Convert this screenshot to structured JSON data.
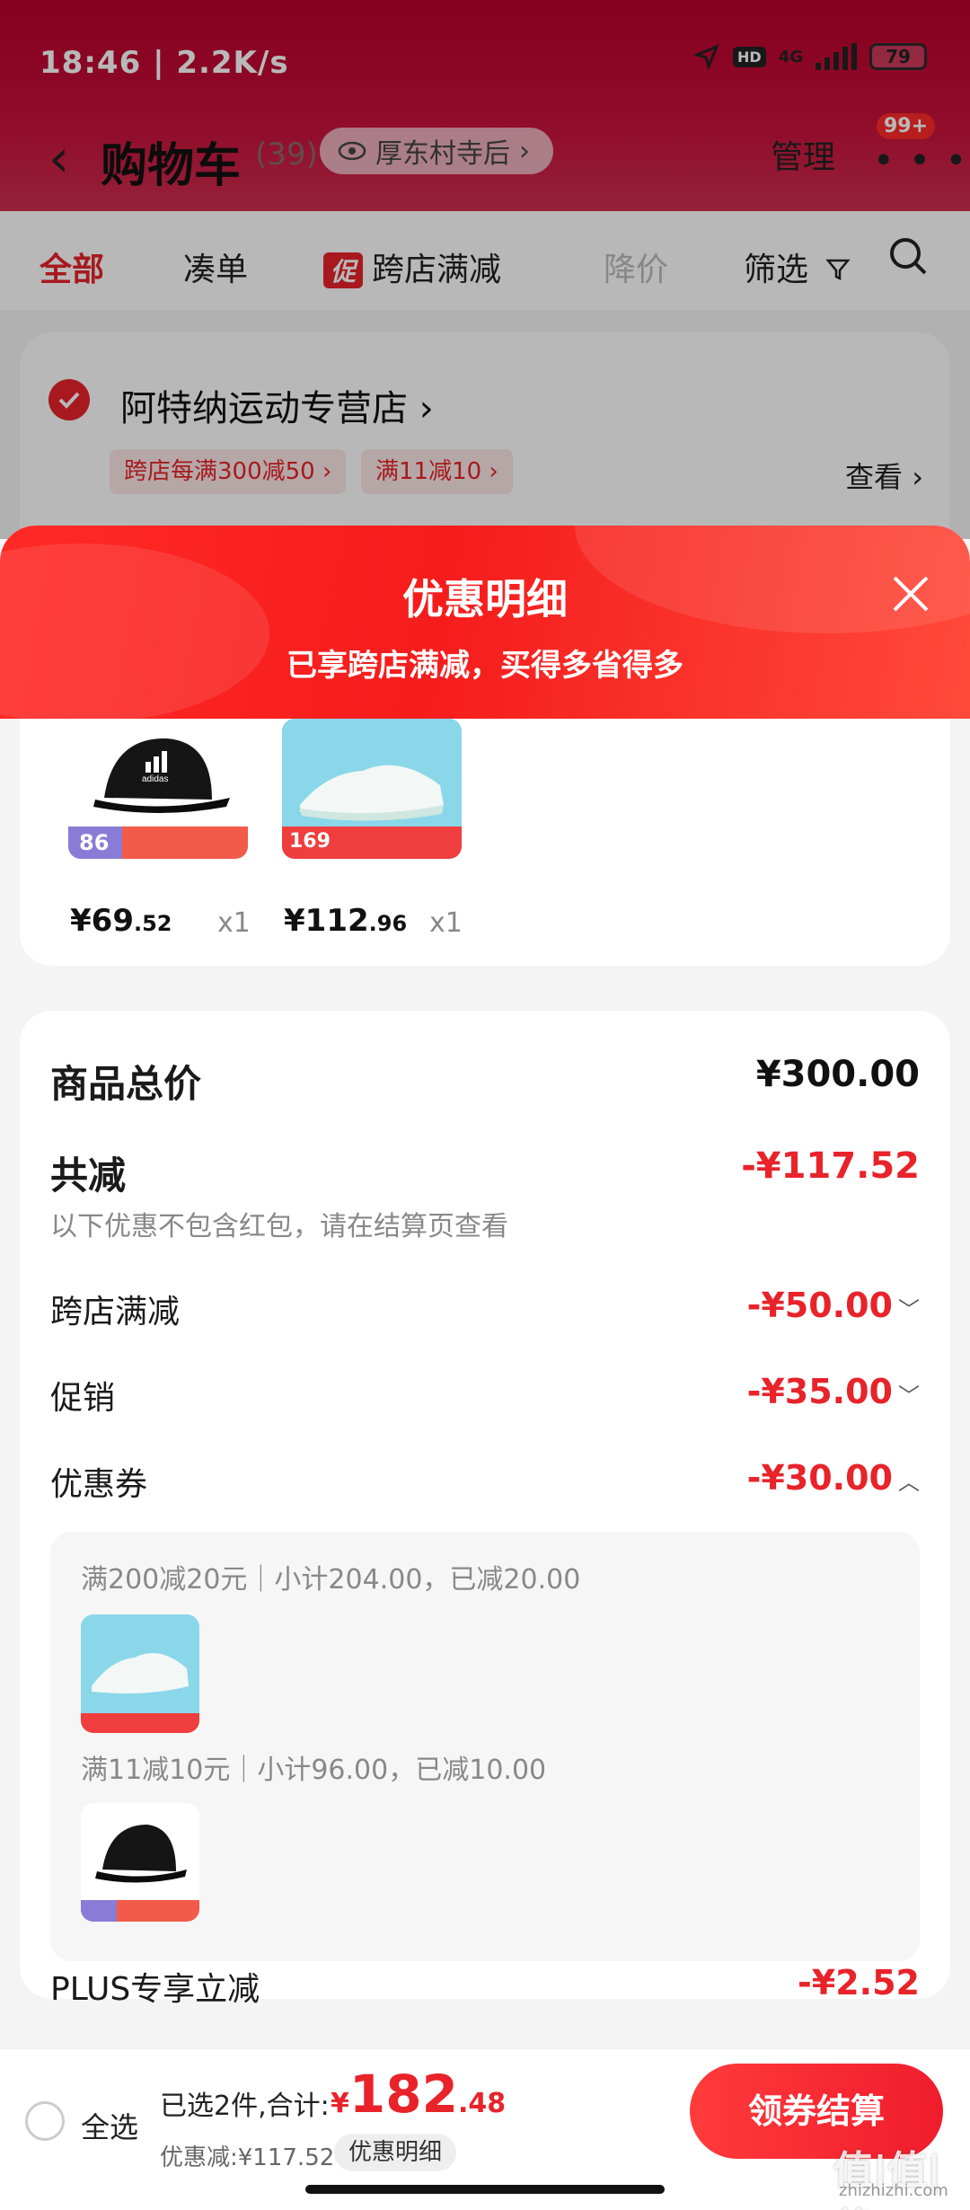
{
  "status_bar": {
    "time": "18:46 | 2.2K/s",
    "hd": "HD",
    "network": "4G",
    "battery": "79"
  },
  "header": {
    "title": "购物车",
    "count": "(39)",
    "location": "厚东村寺后",
    "manage": "管理",
    "more_badge": "99+"
  },
  "tabs": [
    {
      "label": "全部"
    },
    {
      "label": "凑单"
    },
    {
      "tag": "促",
      "label": "跨店满减"
    },
    {
      "label": "降价"
    },
    {
      "label": "筛选"
    }
  ],
  "store": {
    "name": "阿特纳运动专营店",
    "tags": [
      "跨店每满300减50",
      "满11减10"
    ],
    "see_label": "查看"
  },
  "sheet": {
    "title": "优惠明细",
    "subtitle": "已享跨店满减，买得多省得多"
  },
  "products": [
    {
      "name": "adidas cap",
      "price_int": "¥69",
      "price_dec": ".52",
      "qty": "x1",
      "badge": "86"
    },
    {
      "name": "running shoe",
      "price_int": "¥112",
      "price_dec": ".96",
      "qty": "x1",
      "badge": "169"
    }
  ],
  "breakdown": {
    "total_label": "商品总价",
    "total_value": "¥300.00",
    "reduce_label": "共减",
    "reduce_value": "-¥117.52",
    "note": "以下优惠不包含红包，请在结算页查看",
    "cross_store_label": "跨店满减",
    "cross_store_value": "-¥50.00",
    "promo_label": "促销",
    "promo_value": "-¥35.00",
    "coupon_label": "优惠券",
    "coupon_value": "-¥30.00",
    "coupon_details": [
      {
        "text": "满200减20元｜小计204.00，已减20.00"
      },
      {
        "text": "满11减10元｜小计96.00，已减10.00"
      }
    ],
    "plus_label": "PLUS专享立减",
    "plus_value": "-¥2.52"
  },
  "bottom": {
    "select_all": "全选",
    "selected_text": "已选2件,合计:",
    "currency": "¥",
    "total_int": "182",
    "total_dec": ".48",
    "discount_text": "优惠减:¥117.52",
    "detail_chip": "优惠明细",
    "checkout": "领券结算"
  },
  "watermark": {
    "main": "值|值|值",
    "sub": "zhizhizhi.com"
  },
  "colors": {
    "accent": "#e8232a",
    "header_red": "#c9123d"
  }
}
